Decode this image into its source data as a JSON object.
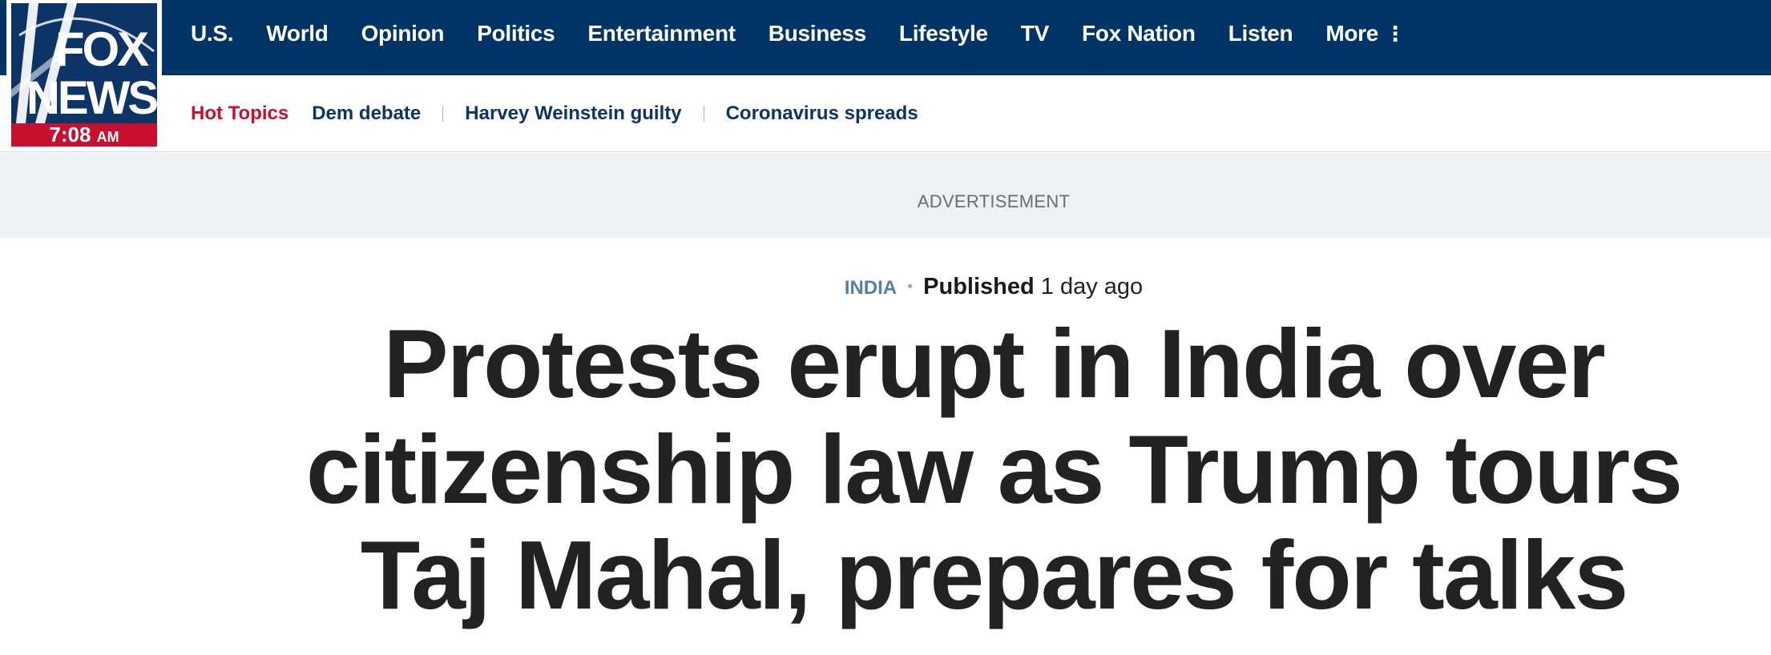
{
  "brand": {
    "logo_text_top": "FOX",
    "logo_text_bottom": "NEWS",
    "clock_time": "7:08",
    "clock_ampm": "AM",
    "colors": {
      "navy": "#003366",
      "red": "#c8102e"
    }
  },
  "nav": {
    "items": [
      {
        "label": "U.S."
      },
      {
        "label": "World"
      },
      {
        "label": "Opinion"
      },
      {
        "label": "Politics"
      },
      {
        "label": "Entertainment"
      },
      {
        "label": "Business"
      },
      {
        "label": "Lifestyle"
      },
      {
        "label": "TV"
      },
      {
        "label": "Fox Nation"
      },
      {
        "label": "Listen"
      },
      {
        "label": "More",
        "icon": "more-vertical-dots-icon"
      }
    ]
  },
  "hot_topics": {
    "label": "Hot Topics",
    "items": [
      {
        "label": "Dem debate"
      },
      {
        "label": "Harvey Weinstein guilty"
      },
      {
        "label": "Coronavirus spreads"
      }
    ]
  },
  "ad": {
    "label": "ADVERTISEMENT"
  },
  "article": {
    "category": "INDIA",
    "published_label": "Published",
    "published_time": "1 day ago",
    "headline": "Protests erupt in India over citizenship law as Trump tours Taj Mahal, prepares for talks"
  }
}
